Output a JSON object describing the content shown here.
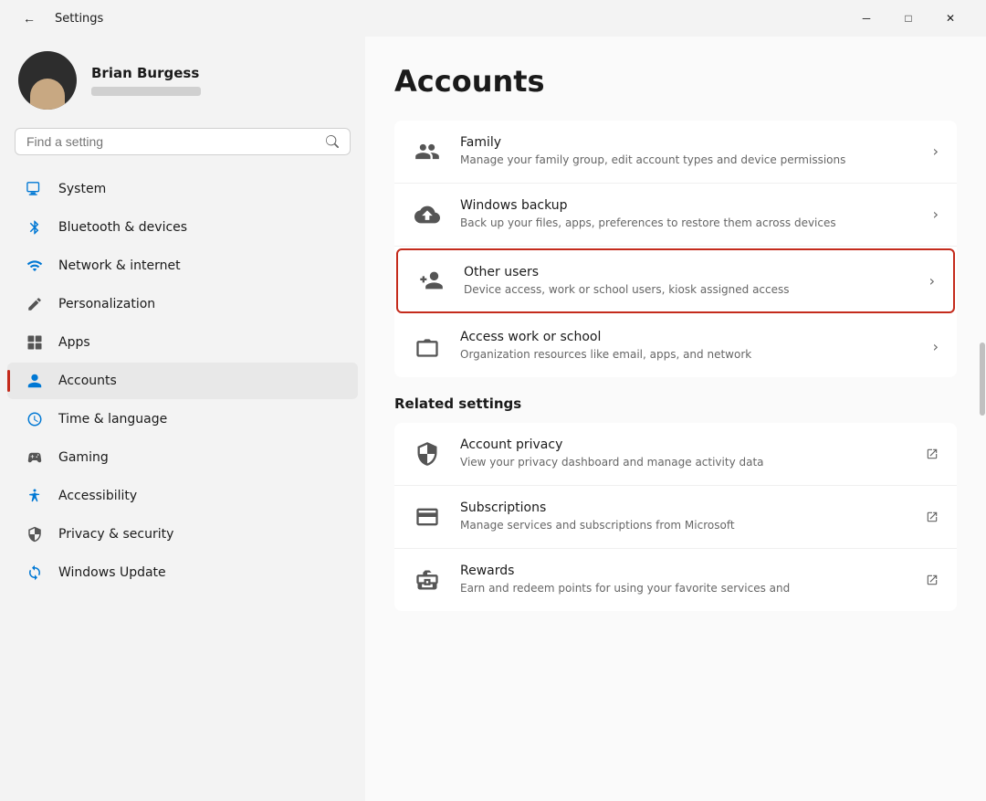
{
  "window": {
    "title": "Settings",
    "controls": {
      "minimize": "─",
      "maximize": "□",
      "close": "✕"
    }
  },
  "user": {
    "name": "Brian Burgess",
    "email_placeholder": "••••••••••••"
  },
  "search": {
    "placeholder": "Find a setting"
  },
  "nav": {
    "items": [
      {
        "id": "system",
        "label": "System",
        "icon": "system"
      },
      {
        "id": "bluetooth",
        "label": "Bluetooth & devices",
        "icon": "bluetooth"
      },
      {
        "id": "network",
        "label": "Network & internet",
        "icon": "network"
      },
      {
        "id": "personalization",
        "label": "Personalization",
        "icon": "personalization"
      },
      {
        "id": "apps",
        "label": "Apps",
        "icon": "apps"
      },
      {
        "id": "accounts",
        "label": "Accounts",
        "icon": "accounts",
        "active": true
      },
      {
        "id": "time",
        "label": "Time & language",
        "icon": "time"
      },
      {
        "id": "gaming",
        "label": "Gaming",
        "icon": "gaming"
      },
      {
        "id": "accessibility",
        "label": "Accessibility",
        "icon": "accessibility"
      },
      {
        "id": "privacy",
        "label": "Privacy & security",
        "icon": "privacy"
      },
      {
        "id": "update",
        "label": "Windows Update",
        "icon": "update"
      }
    ]
  },
  "main": {
    "page_title": "Accounts",
    "items": [
      {
        "id": "family",
        "title": "Family",
        "desc": "Manage your family group, edit account types and device permissions",
        "icon": "family",
        "arrow": true
      },
      {
        "id": "windows-backup",
        "title": "Windows backup",
        "desc": "Back up your files, apps, preferences to restore them across devices",
        "icon": "backup",
        "arrow": true
      },
      {
        "id": "other-users",
        "title": "Other users",
        "desc": "Device access, work or school users, kiosk assigned access",
        "icon": "other-users",
        "arrow": true,
        "highlighted": true
      },
      {
        "id": "access-work",
        "title": "Access work or school",
        "desc": "Organization resources like email, apps, and network",
        "icon": "work",
        "arrow": true
      }
    ],
    "related_settings_title": "Related settings",
    "related_items": [
      {
        "id": "account-privacy",
        "title": "Account privacy",
        "desc": "View your privacy dashboard and manage activity data",
        "icon": "shield",
        "external": true
      },
      {
        "id": "subscriptions",
        "title": "Subscriptions",
        "desc": "Manage services and subscriptions from Microsoft",
        "icon": "subscriptions",
        "external": true
      },
      {
        "id": "rewards",
        "title": "Rewards",
        "desc": "Earn and redeem points for using your favorite services and",
        "icon": "rewards",
        "external": true
      }
    ]
  }
}
